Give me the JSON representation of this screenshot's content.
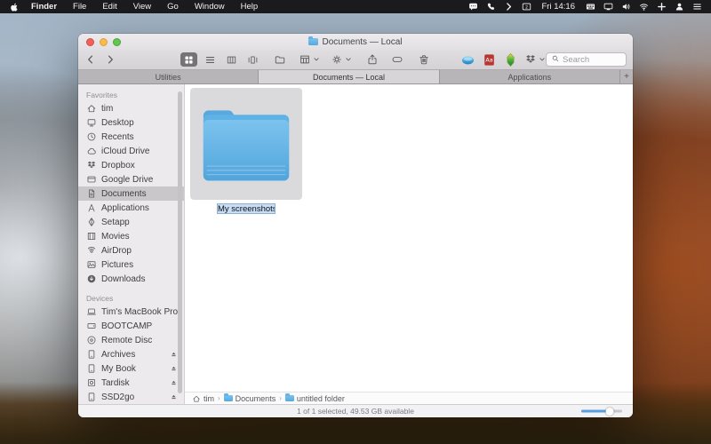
{
  "menubar": {
    "items": [
      "Finder",
      "File",
      "Edit",
      "View",
      "Go",
      "Window",
      "Help"
    ],
    "active_app": "Finder",
    "status_icons_left": [
      "chat",
      "phone",
      "chevron",
      "window-2"
    ],
    "clock": "Fri 14:16",
    "status_icons_right": [
      "keyboard",
      "display",
      "volume",
      "wifi",
      "plus",
      "user",
      "list"
    ]
  },
  "window": {
    "title": "Documents — Local"
  },
  "toolbar": {
    "view_modes": [
      "icon-view",
      "list-view",
      "column-view",
      "coverflow-view"
    ],
    "active_view": "icon-view",
    "search_placeholder": "Search"
  },
  "tabs": {
    "items": [
      {
        "label": "Utilities",
        "active": false
      },
      {
        "label": "Documents — Local",
        "active": true
      },
      {
        "label": "Applications",
        "active": false
      }
    ],
    "add_label": "+"
  },
  "sidebar": {
    "sections": [
      {
        "title": "Favorites",
        "items": [
          {
            "label": "tim",
            "icon": "home"
          },
          {
            "label": "Desktop",
            "icon": "desktop"
          },
          {
            "label": "Recents",
            "icon": "clock"
          },
          {
            "label": "iCloud Drive",
            "icon": "cloud"
          },
          {
            "label": "Dropbox",
            "icon": "dropbox"
          },
          {
            "label": "Google Drive",
            "icon": "gdrive"
          },
          {
            "label": "Documents",
            "icon": "document",
            "selected": true
          },
          {
            "label": "Applications",
            "icon": "app-a"
          },
          {
            "label": "Setapp",
            "icon": "setapp"
          },
          {
            "label": "Movies",
            "icon": "movies"
          },
          {
            "label": "AirDrop",
            "icon": "airdrop"
          },
          {
            "label": "Pictures",
            "icon": "pictures"
          },
          {
            "label": "Downloads",
            "icon": "downloads"
          }
        ]
      },
      {
        "title": "Devices",
        "items": [
          {
            "label": "Tim's MacBook Pro",
            "icon": "laptop"
          },
          {
            "label": "BOOTCAMP",
            "icon": "internal-drive"
          },
          {
            "label": "Remote Disc",
            "icon": "disc"
          },
          {
            "label": "Archives",
            "icon": "external-drive",
            "eject": true
          },
          {
            "label": "My Book",
            "icon": "external-drive",
            "eject": true
          },
          {
            "label": "Tardisk",
            "icon": "tardisk",
            "eject": true
          },
          {
            "label": "SSD2go",
            "icon": "external-drive",
            "eject": true
          }
        ]
      }
    ]
  },
  "main": {
    "items": [
      {
        "name": "My screenshots",
        "type": "folder",
        "selected": true,
        "editing": true
      }
    ]
  },
  "pathbar": {
    "segments": [
      {
        "label": "tim",
        "icon": "home"
      },
      {
        "label": "Documents",
        "icon": "folder"
      },
      {
        "label": "untitled folder",
        "icon": "folder"
      }
    ]
  },
  "statusbar": {
    "text": "1 of 1 selected, 49.53 GB available"
  },
  "colors": {
    "menubar_bg": "#1b1b1d",
    "folder_blue": "#5fb2e6",
    "sidebar_selection": "#c9c7ca",
    "slider_blue": "#5a9ee0",
    "name_edit_bg": "#c7ddf6"
  }
}
